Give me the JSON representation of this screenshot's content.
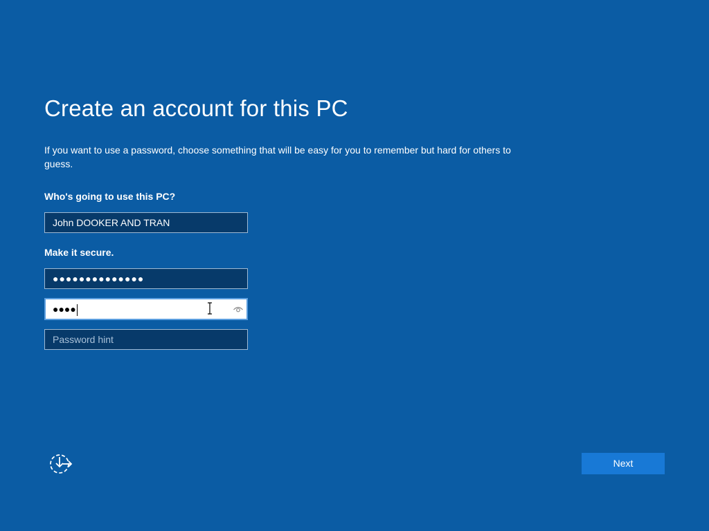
{
  "page": {
    "title": "Create an account for this PC",
    "description": "If you want to use a password, choose something that will be easy for you to remember but hard for others to guess."
  },
  "user_section": {
    "label": "Who's going to use this PC?",
    "username_value": "John DOOKER AND TRAN"
  },
  "secure_section": {
    "label": "Make it secure.",
    "password_value": "●●●●●●●●●●●●●●",
    "confirm_value": "●●●●",
    "hint_placeholder": "Password hint"
  },
  "footer": {
    "next_label": "Next",
    "accessibility_icon": "ease-of-access-icon"
  },
  "colors": {
    "background": "#0b5ca4",
    "field_background": "#073a6a",
    "button_background": "#1879d6"
  }
}
